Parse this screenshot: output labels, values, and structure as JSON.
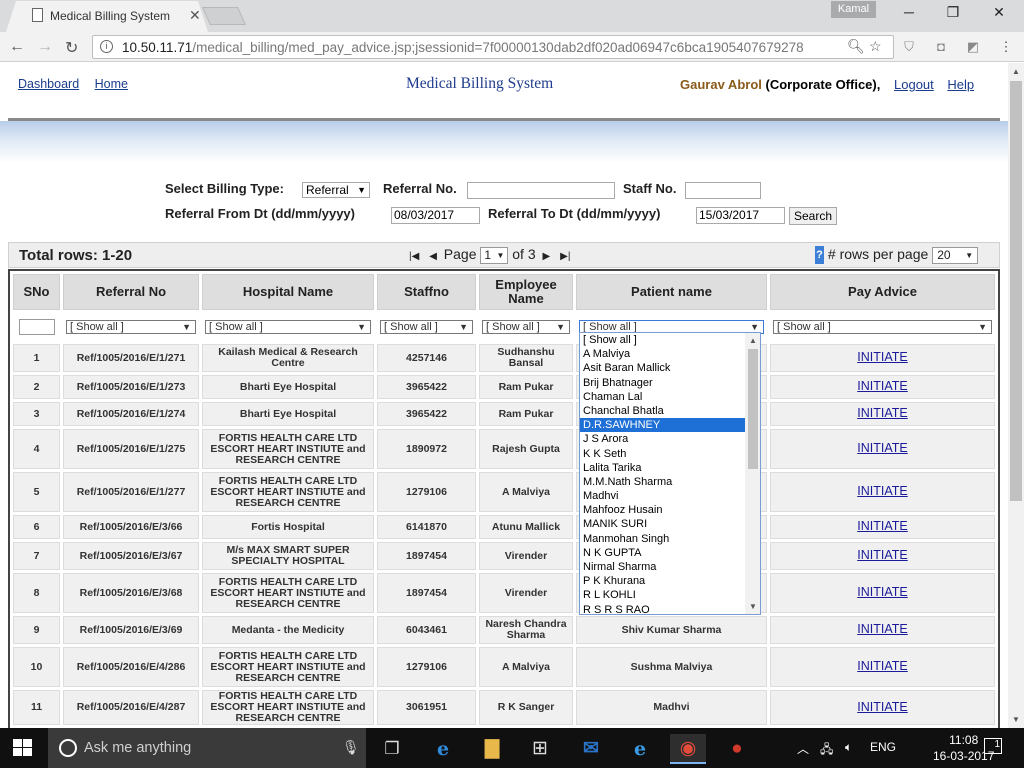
{
  "browser": {
    "tab_title": "Medical Billing System",
    "profile": "Kamal",
    "url_host": "10.50.11.71",
    "url_path": "/medical_billing/med_pay_advice.jsp;jsessionid=7f00000130dab2df020ad06947c6bca1905407679278"
  },
  "header": {
    "links": [
      "Dashboard",
      "Home"
    ],
    "app_title": "Medical Billing System",
    "user_name": "Gaurav Abrol",
    "user_office": "Corporate Office",
    "logout": "Logout",
    "help": "Help"
  },
  "filters": {
    "billing_type_label": "Select Billing Type:",
    "billing_type_value": "Referral",
    "referral_no_label": "Referral No.",
    "staff_no_label": "Staff No.",
    "from_label": "Referral From Dt (dd/mm/yyyy)",
    "from_value": "08/03/2017",
    "to_label": "Referral To Dt (dd/mm/yyyy)",
    "to_value": "15/03/2017",
    "search_button": "Search"
  },
  "grid_bar": {
    "total_rows": "Total rows: 1-20",
    "page_label": "Page",
    "page_value": "1",
    "of_label": "of",
    "page_total": "3",
    "rows_per_page_label": "# rows per page",
    "rows_per_page_value": "20",
    "help_icon": "?"
  },
  "table": {
    "headers": [
      "SNo",
      "Referral No",
      "Hospital Name",
      "Staffno",
      "Employee Name",
      "Patient name",
      "Pay Advice"
    ],
    "show_all": "[ Show all ]",
    "rows": [
      [
        "1",
        "Ref/1005/2016/E/1/271",
        "Kailash Medical & Research Centre",
        "4257146",
        "Sudhanshu Bansal",
        "",
        "INITIATE"
      ],
      [
        "2",
        "Ref/1005/2016/E/1/273",
        "Bharti Eye Hospital",
        "3965422",
        "Ram Pukar",
        "",
        "INITIATE"
      ],
      [
        "3",
        "Ref/1005/2016/E/1/274",
        "Bharti Eye Hospital",
        "3965422",
        "Ram Pukar",
        "",
        "INITIATE"
      ],
      [
        "4",
        "Ref/1005/2016/E/1/275",
        "FORTIS HEALTH CARE LTD ESCORT HEART INSTIUTE and RESEARCH CENTRE",
        "1890972",
        "Rajesh Gupta",
        "",
        "INITIATE"
      ],
      [
        "5",
        "Ref/1005/2016/E/1/277",
        "FORTIS HEALTH CARE LTD ESCORT HEART INSTIUTE and RESEARCH CENTRE",
        "1279106",
        "A Malviya",
        "",
        "INITIATE"
      ],
      [
        "6",
        "Ref/1005/2016/E/3/66",
        "Fortis Hospital",
        "6141870",
        "Atunu Mallick",
        "",
        "INITIATE"
      ],
      [
        "7",
        "Ref/1005/2016/E/3/67",
        "M/s MAX SMART SUPER SPECIALTY HOSPITAL",
        "1897454",
        "Virender",
        "",
        "INITIATE"
      ],
      [
        "8",
        "Ref/1005/2016/E/3/68",
        "FORTIS HEALTH CARE LTD ESCORT HEART INSTIUTE and RESEARCH CENTRE",
        "1897454",
        "Virender",
        "",
        "INITIATE"
      ],
      [
        "9",
        "Ref/1005/2016/E/3/69",
        "Medanta - the Medicity",
        "6043461",
        "Naresh Chandra Sharma",
        "Shiv Kumar Sharma",
        "INITIATE"
      ],
      [
        "10",
        "Ref/1005/2016/E/4/286",
        "FORTIS HEALTH CARE LTD ESCORT HEART INSTIUTE and RESEARCH CENTRE",
        "1279106",
        "A Malviya",
        "Sushma Malviya",
        "INITIATE"
      ],
      [
        "11",
        "Ref/1005/2016/E/4/287",
        "FORTIS HEALTH CARE LTD ESCORT HEART INSTIUTE and RESEARCH CENTRE",
        "3061951",
        "R K Sanger",
        "Madhvi",
        "INITIATE"
      ]
    ]
  },
  "patient_dropdown": {
    "selected": "D.R.SAWHNEY",
    "options": [
      "[ Show all ]",
      "A Malviya",
      "Asit Baran Mallick",
      "Brij Bhatnager",
      "Chaman Lal",
      "Chanchal Bhatla",
      "D.R.SAWHNEY",
      "J S Arora",
      "K K Seth",
      "Lalita Tarika",
      "M.M.Nath Sharma",
      "Madhvi",
      "Mahfooz Husain",
      "MANIK SURI",
      "Manmohan Singh",
      "N K GUPTA",
      "Nirmal Sharma",
      "P K Khurana",
      "R L KOHLI",
      "R S R S RAO"
    ]
  },
  "taskbar": {
    "search_placeholder": "Ask me anything",
    "language": "ENG",
    "time": "11:08",
    "date": "16-03-2017",
    "notifications": "1"
  },
  "colors": {
    "link": "#1a3c8c",
    "title": "#1f3c8c",
    "user_name": "#8a5a1a",
    "dropdown_selected": "#1e6fd6",
    "table_border": "#444444"
  }
}
